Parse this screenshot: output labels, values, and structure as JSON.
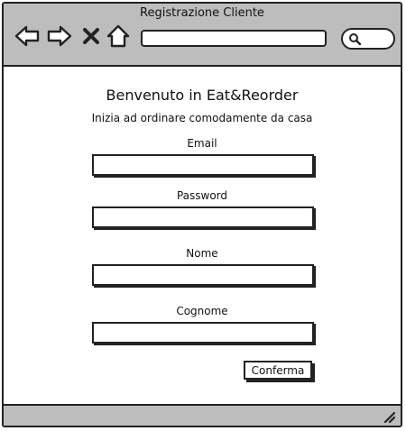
{
  "window": {
    "title": "Registrazione Cliente"
  },
  "toolbar": {
    "icons": [
      "back-arrow-icon",
      "forward-arrow-icon",
      "close-x-icon",
      "home-icon",
      "search-icon"
    ],
    "url_value": "",
    "search_value": ""
  },
  "main": {
    "heading": "Benvenuto in Eat&Reorder",
    "subheading": "Inizia ad ordinare comodamente da casa",
    "fields": [
      {
        "label": "Email",
        "value": ""
      },
      {
        "label": "Password",
        "value": ""
      },
      {
        "label": "Nome",
        "value": ""
      },
      {
        "label": "Cognome",
        "value": ""
      }
    ],
    "confirm_label": "Conferma"
  },
  "colors": {
    "chrome": "#bdbdbd",
    "stroke": "#222222",
    "background": "#ffffff"
  }
}
